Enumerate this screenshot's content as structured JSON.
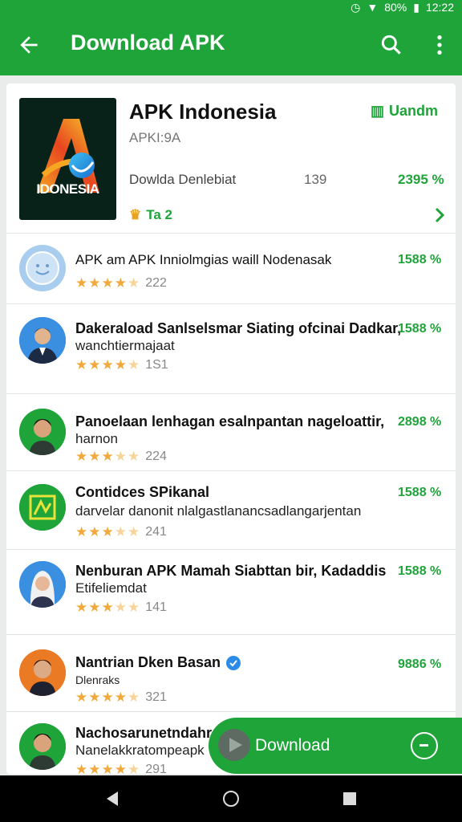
{
  "status": {
    "battery": "80%",
    "time": "12:22"
  },
  "appbar": {
    "title": "Download APK"
  },
  "hero": {
    "title": "APK Indonesia",
    "subtitle": "APKI:9A",
    "install_label": "Uandm",
    "logo_text": "IDONESIA",
    "line": "Dowlda Denlebiat",
    "count": "139",
    "percent": "2395 %",
    "tag": "Ta 2"
  },
  "items": [
    {
      "name": "APK am APK Inniolmgias waill Nodenasak",
      "desc": "",
      "percent": "1588 %",
      "rating_stars": 4.5,
      "rating_count": "222"
    },
    {
      "name": "Dakeraload Sanlselsmar Siating ofcinai Dadkar,",
      "desc": "wanchtiermajaat",
      "percent": "1588 %",
      "rating_stars": 4.5,
      "rating_count": "1S1"
    },
    {
      "name": "Panoelaan lenhagan esalnpantan nageloattir,",
      "desc": "harnon",
      "percent": "2898 %",
      "rating_stars": 3.5,
      "rating_count": "224"
    },
    {
      "name": "Contidces SPikanal",
      "desc": "darvelar danonit nlalgastlanancsadlangarjentan",
      "percent": "1588 %",
      "rating_stars": 3.5,
      "rating_count": "241"
    },
    {
      "name": "Nenburan APK Mamah Siabttan bir, Kadaddis",
      "desc": "Etifeliemdat",
      "percent": "1588 %",
      "rating_stars": 3.5,
      "rating_count": "141"
    },
    {
      "name": "Nantrian Dken Basan",
      "desc": "Dlenraks",
      "percent": "9886 %",
      "rating_stars": 4.5,
      "rating_count": "321"
    },
    {
      "name": "Nachosarunetndahr",
      "desc": "Nanelakkratompeapk",
      "percent": "",
      "rating_stars": 4.5,
      "rating_count": "291"
    }
  ],
  "fab": {
    "label": "Download"
  }
}
